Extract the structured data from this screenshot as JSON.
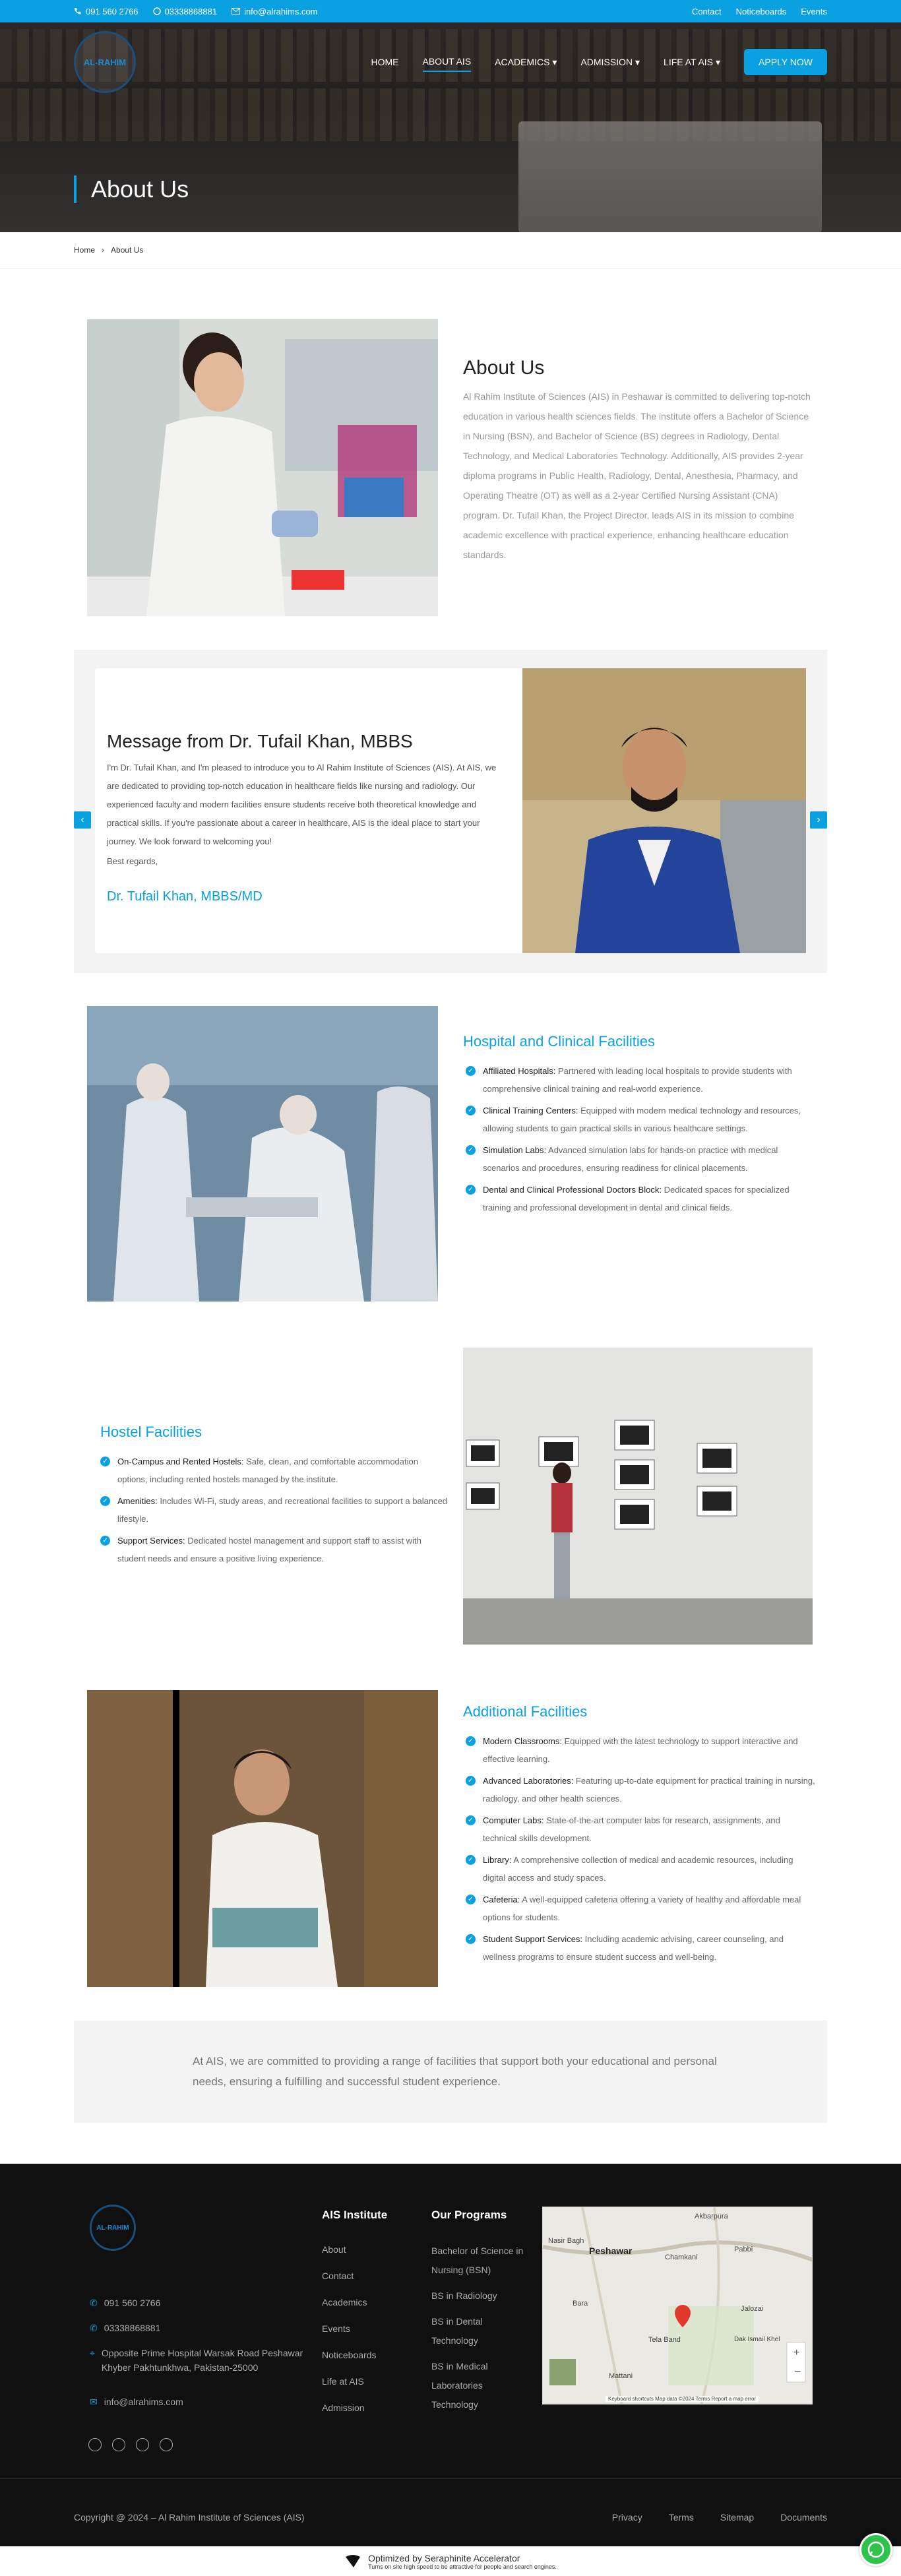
{
  "topbar": {
    "phone1": "091 560 2766",
    "phone2": "03338868881",
    "email": "info@alrahims.com",
    "links": [
      "Contact",
      "Noticeboards",
      "Events"
    ]
  },
  "nav": {
    "logo_text": "AL-RAHIM",
    "items": [
      "HOME",
      "ABOUT AIS",
      "ACADEMICS",
      "ADMISSION",
      "LIFE AT AIS"
    ],
    "apply": "APPLY NOW"
  },
  "hero": {
    "title": "About Us"
  },
  "breadcrumb": {
    "home": "Home",
    "current": "About Us"
  },
  "about": {
    "title": "About Us",
    "text": "Al Rahim Institute of Sciences (AIS) in Peshawar is committed to delivering top-notch education in various health sciences fields. The institute offers a Bachelor of Science in Nursing (BSN), and Bachelor of Science (BS) degrees in Radiology, Dental Technology, and Medical Laboratories Technology. Additionally, AIS provides 2-year diploma programs in Public Health, Radiology, Dental, Anesthesia, Pharmacy, and Operating Theatre (OT) as well as a 2-year Certified Nursing Assistant (CNA) program. Dr. Tufail Khan, the Project Director, leads AIS in its mission to combine academic excellence with practical experience, enhancing healthcare education standards."
  },
  "message": {
    "title": "Message from Dr. Tufail Khan, MBBS",
    "text": "I'm Dr. Tufail Khan, and I'm pleased to introduce you to Al Rahim Institute of Sciences (AIS). At AIS, we are dedicated to providing top-notch education in healthcare fields like nursing and radiology. Our experienced faculty and modern facilities ensure students receive both theoretical knowledge and practical skills. If you're passionate about a career in healthcare, AIS is the ideal place to start your journey. We look forward to welcoming you!",
    "regards": "Best regards,",
    "signature": "Dr. Tufail Khan, MBBS/MD"
  },
  "hospital": {
    "title": "Hospital and Clinical Facilities",
    "items": [
      {
        "label": "Affiliated Hospitals:",
        "text": " Partnered with leading local hospitals to provide students with comprehensive clinical training and real-world experience."
      },
      {
        "label": "Clinical Training Centers:",
        "text": " Equipped with modern medical technology and resources, allowing students to gain practical skills in various healthcare settings."
      },
      {
        "label": "Simulation Labs:",
        "text": " Advanced simulation labs for hands-on practice with medical scenarios and procedures, ensuring readiness for clinical placements."
      },
      {
        "label": "Dental and Clinical Professional Doctors Block:",
        "text": " Dedicated spaces for specialized training and professional development in dental and clinical fields."
      }
    ]
  },
  "hostel": {
    "title": "Hostel Facilities",
    "items": [
      {
        "label": "On-Campus and Rented Hostels:",
        "text": " Safe, clean, and comfortable accommodation options, including rented hostels managed by the institute."
      },
      {
        "label": "Amenities:",
        "text": " Includes Wi-Fi, study areas, and recreational facilities to support a balanced lifestyle."
      },
      {
        "label": "Support Services:",
        "text": " Dedicated hostel management and support staff to assist with student needs and ensure a positive living experience."
      }
    ]
  },
  "additional": {
    "title": "Additional Facilities",
    "items": [
      {
        "label": "Modern Classrooms:",
        "text": " Equipped with the latest technology to support interactive and effective learning."
      },
      {
        "label": "Advanced Laboratories:",
        "text": " Featuring up-to-date equipment for practical training in nursing, radiology, and other health sciences."
      },
      {
        "label": "Computer Labs:",
        "text": " State-of-the-art computer labs for research, assignments, and technical skills development."
      },
      {
        "label": "Library:",
        "text": " A comprehensive collection of medical and academic resources, including digital access and study spaces."
      },
      {
        "label": "Cafeteria:",
        "text": " A well-equipped cafeteria offering a variety of healthy and affordable meal options for students."
      },
      {
        "label": "Student Support Services:",
        "text": " Including academic advising, career counseling, and wellness programs to ensure student success and well-being."
      }
    ]
  },
  "commitment": "At AIS, we are committed to providing a range of facilities that support both your educational and personal needs, ensuring a fulfilling and successful student experience.",
  "footer": {
    "logo_text": "AL-RAHIM",
    "phone1": "091 560 2766",
    "phone2": "03338868881",
    "address": "Opposite Prime Hospital Warsak Road Peshawar Khyber Pakhtunkhwa, Pakistan-25000",
    "email": "info@alrahims.com",
    "col1_title": "AIS Institute",
    "col1": [
      "About",
      "Contact",
      "Academics",
      "Events",
      "Noticeboards",
      "Life at AIS",
      "Admission"
    ],
    "col2_title": "Our Programs",
    "col2": [
      "Bachelor of Science in Nursing (BSN)",
      "BS in Radiology",
      "BS in Dental Technology",
      "BS in Medical Laboratories Technology"
    ],
    "map_labels": [
      "Peshawar",
      "Pabbi",
      "Akbarpura",
      "Nasir Bagh",
      "Chamkani",
      "Jalozai",
      "Tela Band",
      "Mattani",
      "Bara",
      "Dak Ismail Khel"
    ],
    "map_footer": "Keyboard shortcuts   Map data ©2024   Terms   Report a map error",
    "copyright": "Copyright @ 2024 – Al Rahim Institute of Sciences (AIS)",
    "legal": [
      "Privacy",
      "Terms",
      "Sitemap",
      "Documents"
    ]
  },
  "optimizer": {
    "title": "Optimized by Seraphinite Accelerator",
    "subtitle": "Turns on site high speed to be attractive for people and search engines."
  },
  "colors": {
    "accent": "#0aa1e2",
    "footer_bg": "#101010",
    "hero_text": "#ffffff"
  }
}
